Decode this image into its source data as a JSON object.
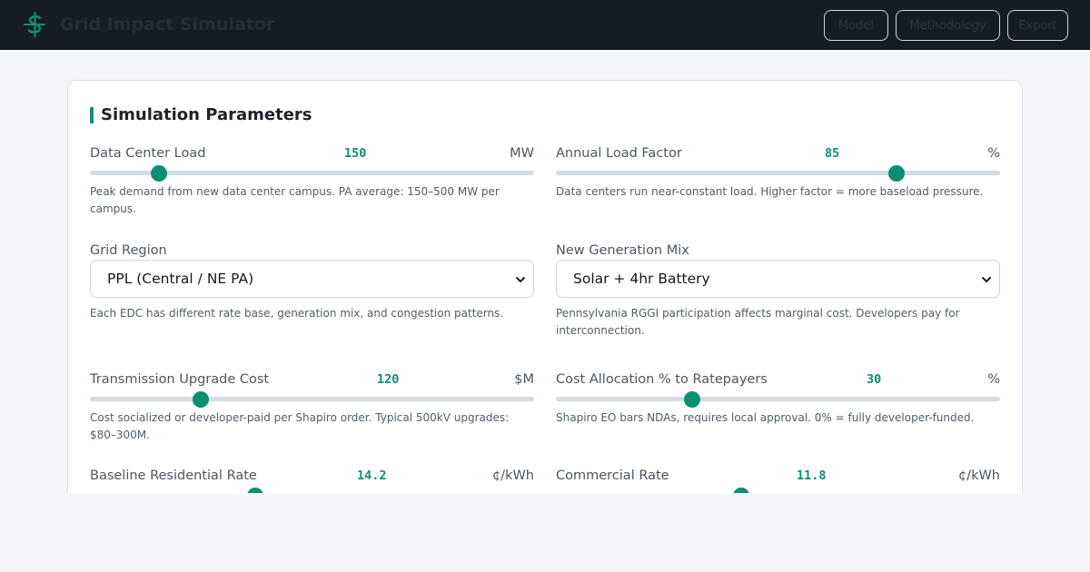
{
  "header": {
    "title": "Grid Impact Simulator",
    "nav": [
      "Model",
      "Methodology",
      "Export"
    ]
  },
  "panel": {
    "title": "Simulation Parameters"
  },
  "controls": {
    "dc_load": {
      "label": "Data Center Load",
      "value": "150",
      "unit": "MW",
      "fill": 0.155,
      "help": "Peak demand from new data center campus. PA average: 150–500 MW per campus."
    },
    "load_factor": {
      "label": "Annual Load Factor",
      "value": "85",
      "unit": "%",
      "fill": 0.767,
      "help": "Data centers run near-constant load. Higher factor = more baseload pressure."
    },
    "grid_region": {
      "label": "Grid Region",
      "value": "PPL (Central / NE PA)",
      "help": "Each EDC has different rate base, generation mix, and congestion patterns."
    },
    "gen_mix": {
      "label": "New Generation Mix",
      "value": "Solar + 4hr Battery",
      "help": "Pennsylvania RGGI participation affects marginal cost. Developers pay for interconnection."
    },
    "tx_cost": {
      "label": "Transmission Upgrade Cost",
      "value": "120",
      "unit": "$M",
      "fill": 0.249,
      "help": "Cost socialized or developer-paid per Shapiro order. Typical 500kV upgrades: $80–300M."
    },
    "cost_alloc": {
      "label": "Cost Allocation % to Ratepayers",
      "value": "30",
      "unit": "%",
      "fill": 0.307,
      "help": "Shapiro EO bars NDAs, requires local approval. 0% = fully developer-funded."
    },
    "res_rate": {
      "label": "Baseline Residential Rate",
      "value": "14.2",
      "unit": "¢/kWh",
      "fill": 0.372
    },
    "com_rate": {
      "label": "Commercial Rate",
      "value": "11.8",
      "unit": "¢/kWh",
      "fill": 0.418
    }
  },
  "colors": {
    "accent": "#0b8f73",
    "header_bg": "#161c23",
    "page_bg": "#f4f6f9"
  },
  "icons": {
    "brand": "dollar-grid-icon",
    "select": "chevron-down-icon"
  }
}
